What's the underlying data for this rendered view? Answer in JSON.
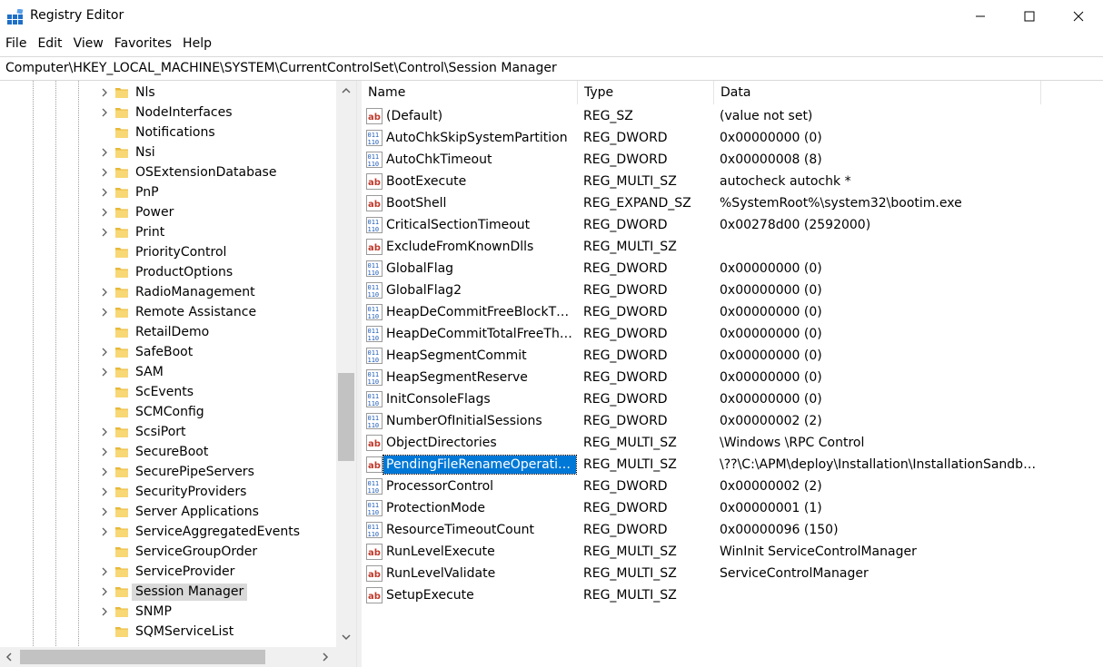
{
  "window": {
    "title": "Registry Editor"
  },
  "menu": [
    "File",
    "Edit",
    "View",
    "Favorites",
    "Help"
  ],
  "address": "Computer\\HKEY_LOCAL_MACHINE\\SYSTEM\\CurrentControlSet\\Control\\Session Manager",
  "tree": {
    "items": [
      {
        "label": "Nls",
        "expandable": true
      },
      {
        "label": "NodeInterfaces",
        "expandable": true
      },
      {
        "label": "Notifications",
        "expandable": false
      },
      {
        "label": "Nsi",
        "expandable": true
      },
      {
        "label": "OSExtensionDatabase",
        "expandable": true
      },
      {
        "label": "PnP",
        "expandable": true
      },
      {
        "label": "Power",
        "expandable": true
      },
      {
        "label": "Print",
        "expandable": true
      },
      {
        "label": "PriorityControl",
        "expandable": false
      },
      {
        "label": "ProductOptions",
        "expandable": false
      },
      {
        "label": "RadioManagement",
        "expandable": true
      },
      {
        "label": "Remote Assistance",
        "expandable": true
      },
      {
        "label": "RetailDemo",
        "expandable": false
      },
      {
        "label": "SafeBoot",
        "expandable": true
      },
      {
        "label": "SAM",
        "expandable": true
      },
      {
        "label": "ScEvents",
        "expandable": false
      },
      {
        "label": "SCMConfig",
        "expandable": false
      },
      {
        "label": "ScsiPort",
        "expandable": true
      },
      {
        "label": "SecureBoot",
        "expandable": true
      },
      {
        "label": "SecurePipeServers",
        "expandable": true
      },
      {
        "label": "SecurityProviders",
        "expandable": true
      },
      {
        "label": "Server Applications",
        "expandable": true
      },
      {
        "label": "ServiceAggregatedEvents",
        "expandable": true
      },
      {
        "label": "ServiceGroupOrder",
        "expandable": false
      },
      {
        "label": "ServiceProvider",
        "expandable": true
      },
      {
        "label": "Session Manager",
        "expandable": true,
        "selected": true
      },
      {
        "label": "SNMP",
        "expandable": true
      },
      {
        "label": "SQMServiceList",
        "expandable": false
      }
    ]
  },
  "list": {
    "columns": {
      "name": "Name",
      "type": "Type",
      "data": "Data"
    },
    "rows": [
      {
        "name": "(Default)",
        "type": "REG_SZ",
        "data": "(value not set)",
        "icon": "string-value-icon"
      },
      {
        "name": "AutoChkSkipSystemPartition",
        "type": "REG_DWORD",
        "data": "0x00000000 (0)",
        "icon": "binary-value-icon"
      },
      {
        "name": "AutoChkTimeout",
        "type": "REG_DWORD",
        "data": "0x00000008 (8)",
        "icon": "binary-value-icon"
      },
      {
        "name": "BootExecute",
        "type": "REG_MULTI_SZ",
        "data": "autocheck autochk *",
        "icon": "string-value-icon"
      },
      {
        "name": "BootShell",
        "type": "REG_EXPAND_SZ",
        "data": "%SystemRoot%\\system32\\bootim.exe",
        "icon": "string-value-icon"
      },
      {
        "name": "CriticalSectionTimeout",
        "type": "REG_DWORD",
        "data": "0x00278d00 (2592000)",
        "icon": "binary-value-icon"
      },
      {
        "name": "ExcludeFromKnownDlls",
        "type": "REG_MULTI_SZ",
        "data": "",
        "icon": "string-value-icon"
      },
      {
        "name": "GlobalFlag",
        "type": "REG_DWORD",
        "data": "0x00000000 (0)",
        "icon": "binary-value-icon"
      },
      {
        "name": "GlobalFlag2",
        "type": "REG_DWORD",
        "data": "0x00000000 (0)",
        "icon": "binary-value-icon"
      },
      {
        "name": "HeapDeCommitFreeBlockThr…",
        "type": "REG_DWORD",
        "data": "0x00000000 (0)",
        "icon": "binary-value-icon"
      },
      {
        "name": "HeapDeCommitTotalFreeThre…",
        "type": "REG_DWORD",
        "data": "0x00000000 (0)",
        "icon": "binary-value-icon"
      },
      {
        "name": "HeapSegmentCommit",
        "type": "REG_DWORD",
        "data": "0x00000000 (0)",
        "icon": "binary-value-icon"
      },
      {
        "name": "HeapSegmentReserve",
        "type": "REG_DWORD",
        "data": "0x00000000 (0)",
        "icon": "binary-value-icon"
      },
      {
        "name": "InitConsoleFlags",
        "type": "REG_DWORD",
        "data": "0x00000000 (0)",
        "icon": "binary-value-icon"
      },
      {
        "name": "NumberOfInitialSessions",
        "type": "REG_DWORD",
        "data": "0x00000002 (2)",
        "icon": "binary-value-icon"
      },
      {
        "name": "ObjectDirectories",
        "type": "REG_MULTI_SZ",
        "data": "\\Windows \\RPC Control",
        "icon": "string-value-icon"
      },
      {
        "name": "PendingFileRenameOperations",
        "type": "REG_MULTI_SZ",
        "data": "\\??\\C:\\APM\\deploy\\Installation\\InstallationSandbo…",
        "icon": "string-value-icon",
        "selected": true
      },
      {
        "name": "ProcessorControl",
        "type": "REG_DWORD",
        "data": "0x00000002 (2)",
        "icon": "binary-value-icon"
      },
      {
        "name": "ProtectionMode",
        "type": "REG_DWORD",
        "data": "0x00000001 (1)",
        "icon": "binary-value-icon"
      },
      {
        "name": "ResourceTimeoutCount",
        "type": "REG_DWORD",
        "data": "0x00000096 (150)",
        "icon": "binary-value-icon"
      },
      {
        "name": "RunLevelExecute",
        "type": "REG_MULTI_SZ",
        "data": "WinInit ServiceControlManager",
        "icon": "string-value-icon"
      },
      {
        "name": "RunLevelValidate",
        "type": "REG_MULTI_SZ",
        "data": "ServiceControlManager",
        "icon": "string-value-icon"
      },
      {
        "name": "SetupExecute",
        "type": "REG_MULTI_SZ",
        "data": "",
        "icon": "string-value-icon"
      }
    ]
  }
}
